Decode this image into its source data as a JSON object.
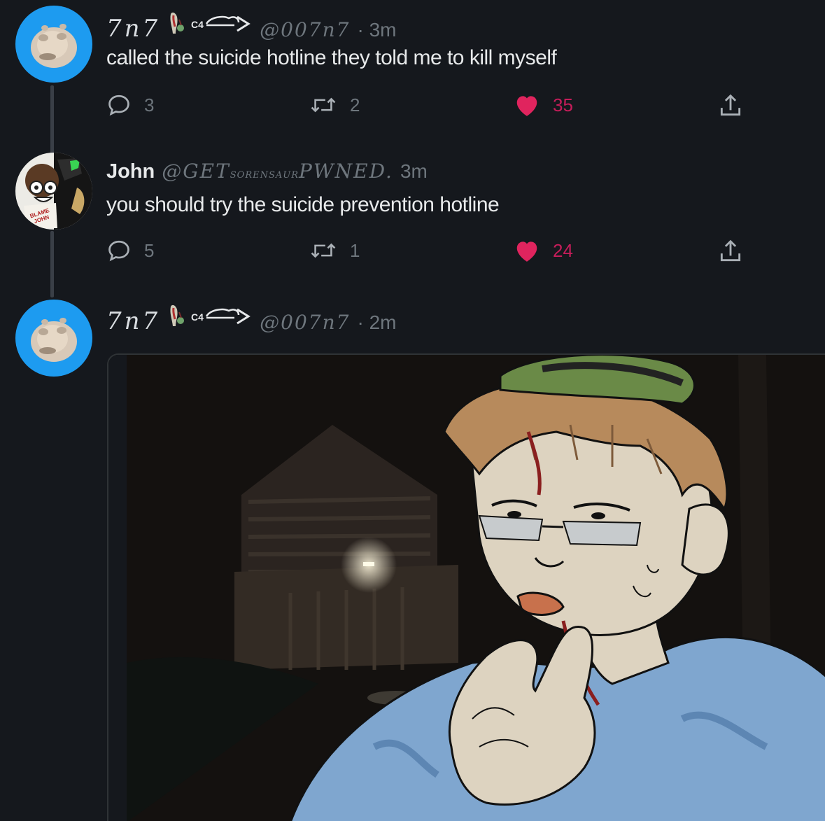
{
  "tweets": [
    {
      "display_name": "7n7",
      "handle": "@007n7",
      "time": "· 3m",
      "text": "called the suicide hotline they told me to kill myself",
      "replies": "3",
      "retweets": "2",
      "likes": "35"
    },
    {
      "display_name": "John",
      "handle_prefix": "@GET",
      "handle_middle": "SORENSAUR",
      "handle_suffix": "PWNED.",
      "time": "3m",
      "text": "you should try the suicide prevention hotline",
      "replies": "5",
      "retweets": "1",
      "likes": "24",
      "avatar_badge": "BLAME JOHN"
    },
    {
      "display_name": "7n7",
      "handle": "@007n7",
      "time": "· 2m"
    }
  ],
  "colors": {
    "background": "#15181d",
    "text": "#e7e9ea",
    "muted": "#6e767d",
    "like": "#c51d5a",
    "avatar_blue": "#1d9bf0"
  },
  "icons": [
    "reply-icon",
    "retweet-icon",
    "like-icon",
    "share-icon"
  ]
}
